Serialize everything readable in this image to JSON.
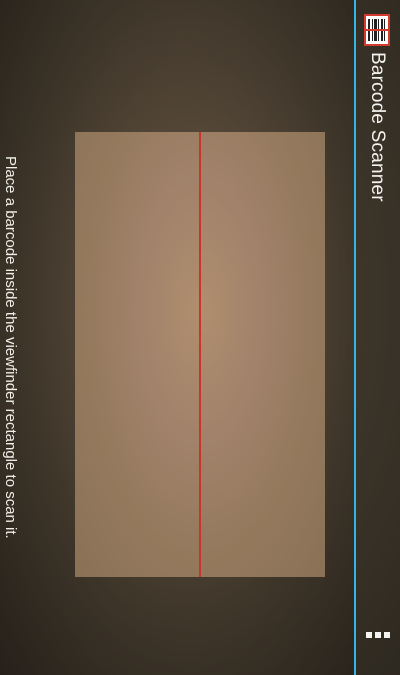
{
  "app": {
    "title": "Barcode Scanner",
    "icon": "barcode-icon"
  },
  "scanner": {
    "status_text": "Place a barcode inside the viewfinder rectangle to scan it.",
    "laser_color": "#c8352a"
  },
  "actionbar": {
    "accent_color": "#33b5e5",
    "overflow_icon": "overflow-menu-icon"
  }
}
